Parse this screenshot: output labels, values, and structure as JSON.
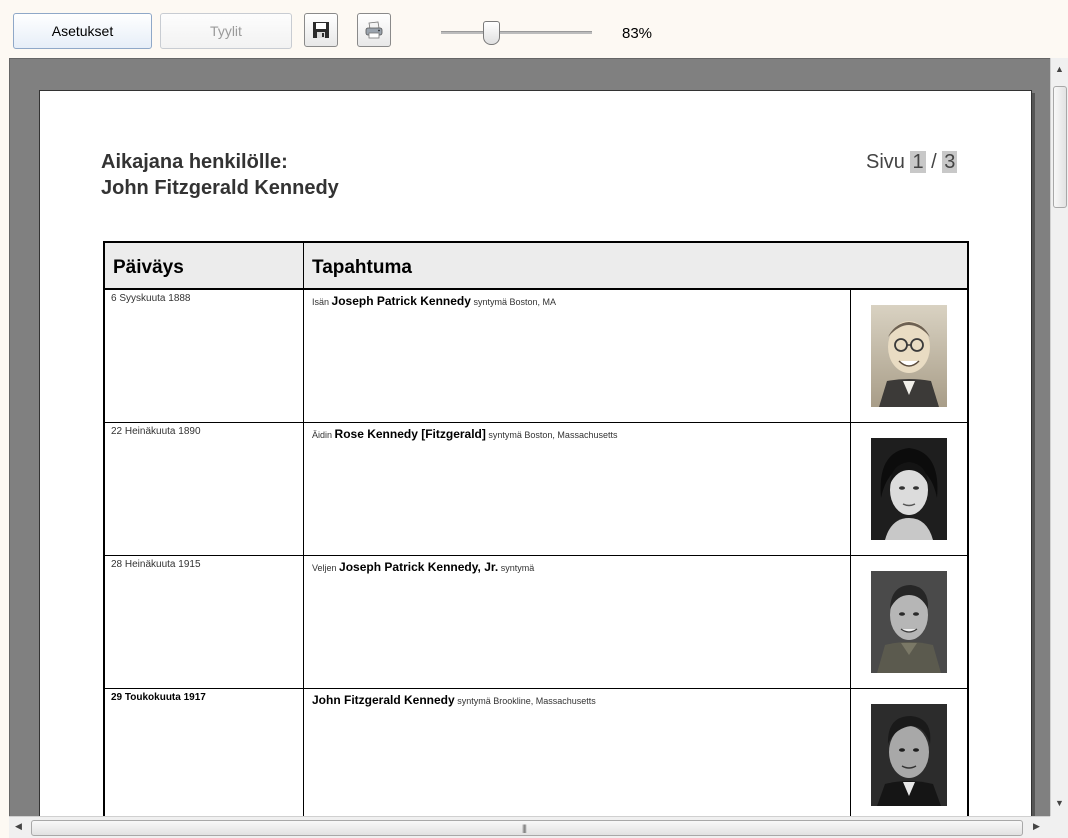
{
  "toolbar": {
    "settings_label": "Asetukset",
    "styles_label": "Tyylit",
    "save_icon": "save-icon",
    "print_icon": "print-icon",
    "zoom_level": 0.83,
    "zoom_label": "83%"
  },
  "page": {
    "title_line1": "Aikajana henkilölle:",
    "title_line2": "John Fitzgerald Kennedy",
    "pager_label": "Sivu",
    "page_current": "1",
    "page_sep": "/",
    "page_total": "3"
  },
  "table": {
    "col_date": "Päiväys",
    "col_event": "Tapahtuma",
    "rows": [
      {
        "date": "6 Syyskuuta 1888",
        "pre": "Isän",
        "name": "Joseph Patrick Kennedy",
        "post": "syntymä Boston, MA"
      },
      {
        "date": "22 Heinäkuuta 1890",
        "pre": "Äidin",
        "name": "Rose Kennedy [Fitzgerald]",
        "post": "syntymä Boston, Massachusetts"
      },
      {
        "date": "28 Heinäkuuta 1915",
        "pre": "Veljen",
        "name": "Joseph Patrick Kennedy, Jr.",
        "post": "syntymä"
      },
      {
        "date": "29 Toukokuuta 1917",
        "pre": "",
        "name": "John Fitzgerald Kennedy",
        "post": "syntymä Brookline, Massachusetts"
      }
    ]
  }
}
